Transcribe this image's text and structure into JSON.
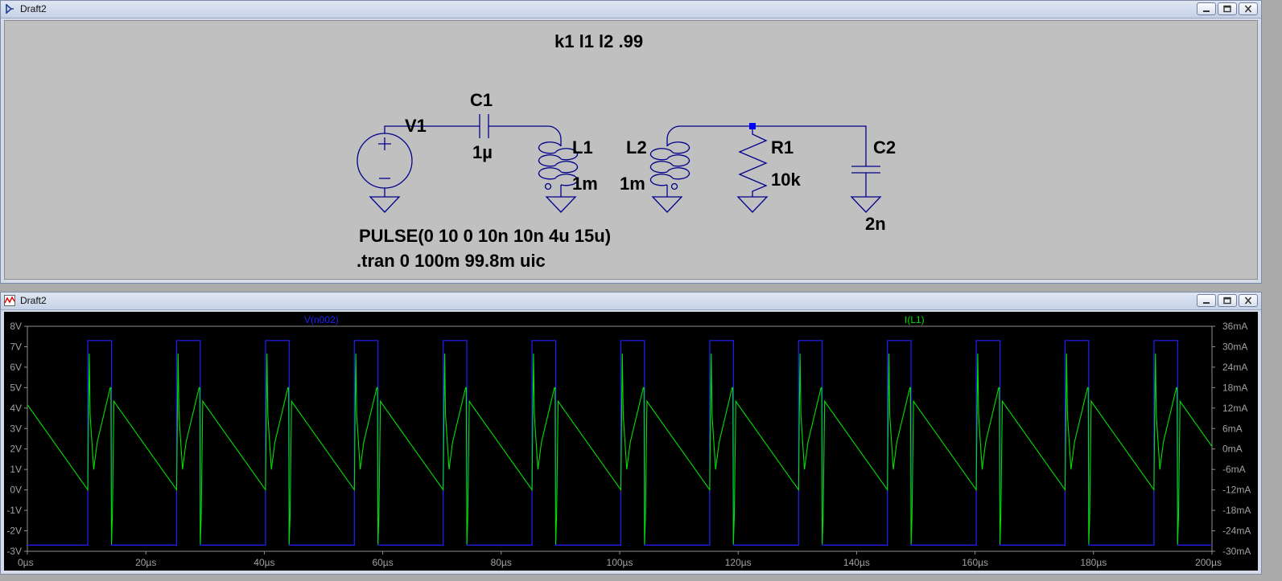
{
  "schematic_window": {
    "title": "Draft2",
    "directive_k": "k1 l1 l2 .99",
    "pulse_source": "PULSE(0 10 0 10n 10n 4u 15u)",
    "tran_directive": ".tran 0 100m 99.8m uic",
    "components": {
      "v1": "V1",
      "c1_name": "C1",
      "c1_value": "1µ",
      "l1_name": "L1",
      "l1_value": "1m",
      "l2_name": "L2",
      "l2_value": "1m",
      "r1_name": "R1",
      "r1_value": "10k",
      "c2_name": "C2",
      "c2_value": "2n"
    },
    "wire_color": "#00008b"
  },
  "plot_window": {
    "title": "Draft2",
    "trace_v_label": "V(n002)",
    "trace_i_label": "I(L1)",
    "v_color": "#2020ff",
    "i_color": "#00e000"
  },
  "chart_data": {
    "type": "line",
    "xlim": [
      0,
      200
    ],
    "x_unit": "µs",
    "x_ticks": [
      "0µs",
      "20µs",
      "40µs",
      "60µs",
      "80µs",
      "100µs",
      "120µs",
      "140µs",
      "160µs",
      "180µs",
      "200µs"
    ],
    "ylim_left": [
      -3,
      8
    ],
    "y_left_ticks": [
      "8V",
      "7V",
      "6V",
      "5V",
      "4V",
      "3V",
      "2V",
      "1V",
      "0V",
      "-1V",
      "-2V",
      "-3V"
    ],
    "ylim_right": [
      -30,
      36
    ],
    "y_right_ticks": [
      "36mA",
      "30mA",
      "24mA",
      "18mA",
      "12mA",
      "6mA",
      "0mA",
      "-6mA",
      "-12mA",
      "-18mA",
      "-24mA",
      "-30mA"
    ],
    "grid": false,
    "series": [
      {
        "name": "V(n002)",
        "axis": "left",
        "period": 15,
        "phase": 10.2,
        "high_duration": 4,
        "high": 7.3,
        "low": -2.7
      },
      {
        "name": "I(L1)",
        "axis": "right",
        "cycle_points": [
          [
            0,
            13
          ],
          [
            10.2,
            -12
          ],
          [
            10.35,
            14
          ],
          [
            10.45,
            28
          ],
          [
            10.6,
            10
          ],
          [
            11.2,
            -6
          ],
          [
            11.8,
            2
          ],
          [
            14.0,
            18
          ],
          [
            14.1,
            18
          ],
          [
            14.2,
            -28
          ],
          [
            14.35,
            -20
          ],
          [
            14.6,
            14
          ],
          [
            15,
            13
          ],
          [
            25.2,
            -12
          ]
        ],
        "cycle_period": 15,
        "cycle_start": 10.2,
        "initial_points": [
          [
            0,
            13
          ],
          [
            10.2,
            -12
          ]
        ]
      }
    ]
  }
}
